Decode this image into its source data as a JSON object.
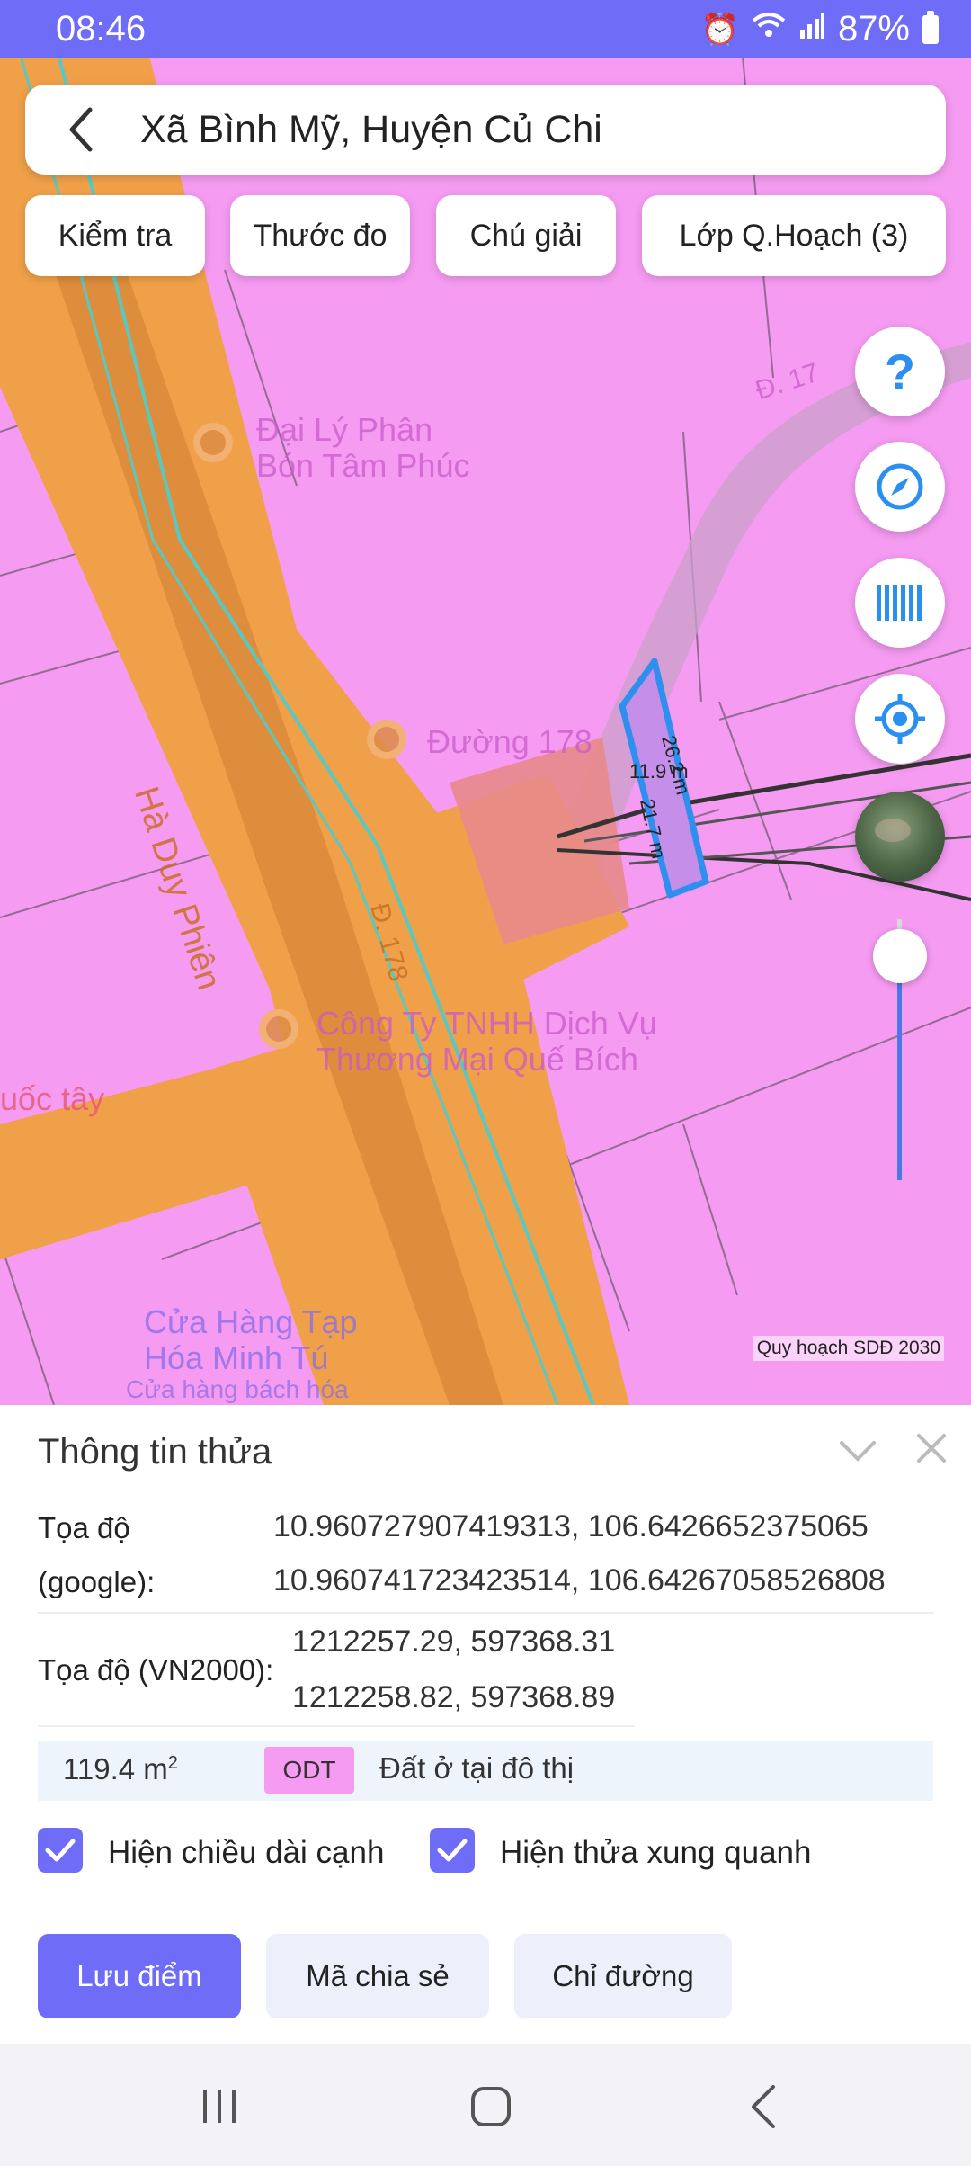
{
  "status_bar": {
    "time": "08:46",
    "battery": "87%"
  },
  "header": {
    "title": "Xã Bình Mỹ, Huyện Củ Chi"
  },
  "toolbar": {
    "check_label": "Kiểm tra",
    "ruler_label": "Thước đo",
    "legend_label": "Chú giải",
    "layers_label": "Lớp Q.Hoạch (3)"
  },
  "map": {
    "caption": "Quy hoạch SDĐ 2030",
    "labels": {
      "poi1_line1": "Đại Lý Phân",
      "poi1_line2": "Bón Tâm Phúc",
      "street1": "Hà Duy Phiên",
      "street2": "Đường 178",
      "street2_short": "Đ. 178",
      "street3": "Đ. 17",
      "poi2_line1": "Công Ty TNHH Dịch Vụ",
      "poi2_line2": "Thương Mại Quế Bích",
      "poi3": "uốc tây",
      "poi4_line1": "Cửa Hàng Tạp",
      "poi4_line2": "Hóa Minh Tú",
      "poi4_line3": "Cửa hàng bách hóa"
    },
    "parcel": {
      "edge_long": "26.2 m",
      "edge_mid": "21.7 m",
      "edge_short": "11.9 m"
    },
    "zoom_level": 0.86,
    "colors": {
      "residential": "#f59bf2",
      "road": "#f0a048",
      "parcel_outline": "#2f8fef",
      "accent": "#6f6df7"
    }
  },
  "sheet": {
    "title": "Thông tin thửa",
    "google_label_1": "Tọa độ",
    "google_label_2": "(google):",
    "google_value_1": "10.960727907419313, 106.6426652375065",
    "google_value_2": "10.960741723423514, 106.64267058526808",
    "vn2000_label": "Tọa độ (VN2000):",
    "vn2000_value_1": "1212257.29, 597368.31",
    "vn2000_value_2": "1212258.82, 597368.89",
    "area_value": "119.4 m",
    "area_unit_sup": "2",
    "land_code": "ODT",
    "land_desc": "Đất ở tại đô thị",
    "show_edges_label": "Hiện chiều dài cạnh",
    "show_edges_checked": true,
    "show_neighbors_label": "Hiện thửa xung quanh",
    "show_neighbors_checked": true,
    "save_label": "Lưu điểm",
    "share_label": "Mã chia sẻ",
    "directions_label": "Chỉ đường"
  },
  "icons": {
    "back": "chevron-left-icon",
    "help": "question-icon",
    "compass": "compass-icon",
    "barcode": "barcode-icon",
    "locate": "locate-icon",
    "nav_recent": "recent-apps-icon",
    "nav_home": "home-icon",
    "nav_back": "back-icon"
  }
}
